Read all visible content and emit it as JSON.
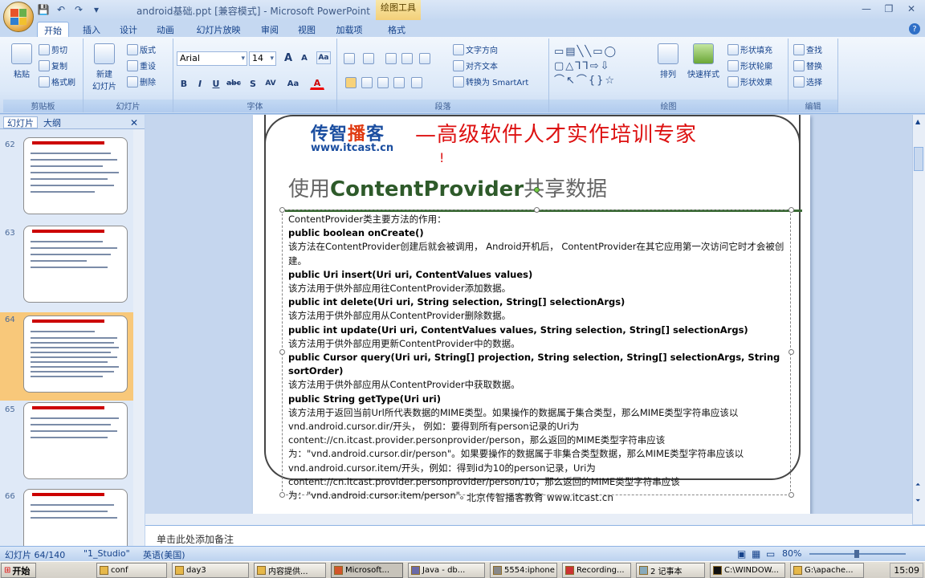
{
  "titlebar": {
    "doc_title": "android基础.ppt [兼容模式] - Microsoft PowerPoint",
    "context_tab": "绘图工具",
    "win_min": "—",
    "win_max": "❐",
    "win_close": "✕"
  },
  "tabs": [
    "开始",
    "插入",
    "设计",
    "动画",
    "幻灯片放映",
    "审阅",
    "视图",
    "加载项",
    "格式"
  ],
  "ribbon": {
    "clipboard": {
      "label": "剪贴板",
      "paste": "粘贴",
      "cut": "剪切",
      "copy": "复制",
      "format_painter": "格式刷"
    },
    "slides": {
      "label": "幻灯片",
      "new_slide": "新建\n幻灯片",
      "layout": "版式",
      "reset": "重设",
      "delete": "删除"
    },
    "font": {
      "label": "字体",
      "font_name": "Arial",
      "font_size": "14",
      "grow": "A",
      "shrink": "A",
      "clear": "Aa",
      "bold": "B",
      "italic": "I",
      "underline": "U",
      "strike": "abc",
      "shadow": "S",
      "spacing": "AV",
      "case": "Aa",
      "color": "A"
    },
    "paragraph": {
      "label": "段落",
      "text_direction": "文字方向",
      "align_text": "对齐文本",
      "smartart": "转换为 SmartArt"
    },
    "drawing": {
      "label": "绘图",
      "arrange": "排列",
      "quick_styles": "快速样式",
      "shape_fill": "形状填充",
      "shape_outline": "形状轮廓",
      "shape_effects": "形状效果"
    },
    "editing": {
      "label": "编辑",
      "find": "查找",
      "replace": "替换",
      "select": "选择"
    }
  },
  "left_pane": {
    "tab_slides": "幻灯片",
    "tab_outline": "大纲",
    "thumbs": [
      {
        "num": "62"
      },
      {
        "num": "63"
      },
      {
        "num": "64"
      },
      {
        "num": "65"
      },
      {
        "num": "66"
      }
    ],
    "selected": "64"
  },
  "slide": {
    "brand_a": "传智",
    "brand_b": "播",
    "brand_c": "客",
    "brand_url": "www.itcast.cn",
    "tagline": "—高级软件人才实作培训专家",
    "tagline_mark": "!",
    "title_a": "使用",
    "title_b": "ContentProvider",
    "title_c": "共享数据",
    "lines": [
      {
        "t": "ContentProvider类主要方法的作用：",
        "sig": false
      },
      {
        "t": "public boolean onCreate()",
        "sig": true
      },
      {
        "t": "该方法在ContentProvider创建后就会被调用， Android开机后， ContentProvider在其它应用第一次访问它时才会被创建。",
        "sig": false
      },
      {
        "t": "public Uri insert(Uri uri, ContentValues values)",
        "sig": true
      },
      {
        "t": "该方法用于供外部应用往ContentProvider添加数据。",
        "sig": false
      },
      {
        "t": "public int delete(Uri uri, String selection, String[] selectionArgs)",
        "sig": true
      },
      {
        "t": "该方法用于供外部应用从ContentProvider删除数据。",
        "sig": false
      },
      {
        "t": "public int update(Uri uri, ContentValues values, String selection, String[] selectionArgs)",
        "sig": true
      },
      {
        "t": "该方法用于供外部应用更新ContentProvider中的数据。",
        "sig": false
      },
      {
        "t": "public Cursor query(Uri uri, String[] projection, String selection, String[] selectionArgs, String sortOrder)",
        "sig": true
      },
      {
        "t": "该方法用于供外部应用从ContentProvider中获取数据。",
        "sig": false
      },
      {
        "t": "public String getType(Uri uri)",
        "sig": true
      },
      {
        "t": "该方法用于返回当前Url所代表数据的MIME类型。如果操作的数据属于集合类型，那么MIME类型字符串应该以vnd.android.cursor.dir/开头， 例如：要得到所有person记录的Uri为content://cn.itcast.provider.personprovider/person，那么返回的MIME类型字符串应该为：\"vnd.android.cursor.dir/person\"。如果要操作的数据属于非集合类型数据，那么MIME类型字符串应该以vnd.android.cursor.item/开头，例如：得到id为10的person记录，Uri为content://cn.itcast.provider.personprovider/person/10，那么返回的MIME类型字符串应该为：\"vnd.android.cursor.item/person\"。",
        "sig": false
      }
    ],
    "footer": "北京传智播客教育 www.itcast.cn"
  },
  "notes_placeholder": "单击此处添加备注",
  "status": {
    "slide_pos": "幻灯片 64/140",
    "theme": "\"1_Studio\"",
    "lang": "英语(美国)",
    "zoom": "80%"
  },
  "taskbar": {
    "start": "开始",
    "tasks": [
      "conf",
      "day3",
      "内容提供...",
      "Microsoft...",
      "Java - db...",
      "5554:iphone",
      "Recording...",
      "2 记事本",
      "C:\\WINDOW...",
      "G:\\apache..."
    ],
    "clock": "15:09"
  }
}
